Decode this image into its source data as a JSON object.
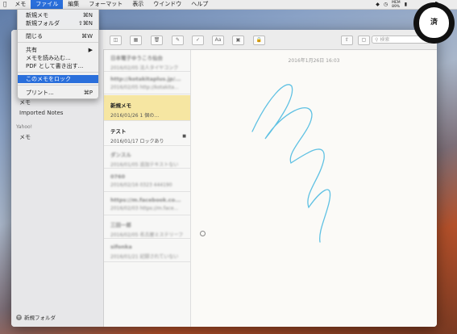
{
  "menubar": {
    "items": [
      "メモ",
      "ファイル",
      "編集",
      "フォーマット",
      "表示",
      "ウインドウ",
      "ヘルプ"
    ],
    "active": "ファイル",
    "battery": "89%",
    "battery_label": "MEM"
  },
  "file_menu": {
    "items": [
      {
        "label": "新規メモ",
        "shortcut": "⌘N"
      },
      {
        "label": "新規フォルダ",
        "shortcut": "⇧⌘N"
      },
      {
        "label": "閉じる",
        "shortcut": "⌘W"
      },
      {
        "label": "共有",
        "shortcut": "▶"
      },
      {
        "label": "メモを読み込む..."
      },
      {
        "label": "PDF として書き出す..."
      },
      {
        "label": "このメモをロック"
      },
      {
        "label": "プリント...",
        "shortcut": "⌘P"
      }
    ],
    "highlighted": "このメモをロック"
  },
  "sidebar": {
    "items": [
      "メモ",
      "Imported Notes"
    ],
    "group": "Yahoo!",
    "group_items": [
      "メモ"
    ],
    "new_folder": "新規フォルダ"
  },
  "toolbar": {
    "search_placeholder": "検索"
  },
  "notes": [
    {
      "title": "日本電子ゆうころ仙台",
      "subtitle": "2016/02/05 法人タイヤコンク"
    },
    {
      "title": "http://kotakitaplus.jp/...",
      "subtitle": "2016/02/05 http://kotakita..."
    },
    {
      "title": "新規メモ",
      "subtitle": "2016/01/26 1 個の…"
    },
    {
      "title": "テスト",
      "subtitle": "2016/01/17 ロックあり"
    },
    {
      "title": "ダンスル",
      "subtitle": "2016/01/05 追加テキストない"
    },
    {
      "title": "0760",
      "subtitle": "2016/02/16 0323 444190"
    },
    {
      "title": "https://m.facebook.co...",
      "subtitle": "2016/02/03 https://m.face..."
    },
    {
      "title": "三田一郎",
      "subtitle": "2016/02/05 名古屋ミステリーフ"
    },
    {
      "title": "sifonka",
      "subtitle": "2016/01/21 記録されていない"
    }
  ],
  "editor": {
    "date": "2016年1月26日 16:03"
  },
  "badge": {
    "text": "済"
  },
  "colors": {
    "accent": "#2a6fdb",
    "selected_note": "#f6e6a2",
    "sketch": "#5fc1e3"
  }
}
